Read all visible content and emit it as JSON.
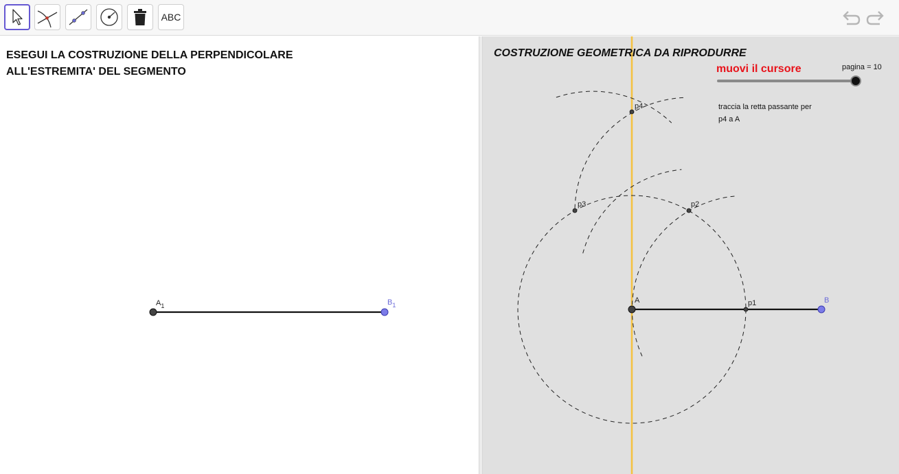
{
  "toolbar": {
    "tools": [
      {
        "name": "move",
        "icon": "cursor-arrow-icon",
        "active": true
      },
      {
        "name": "intersect",
        "icon": "intersect-icon"
      },
      {
        "name": "segment",
        "icon": "segment-icon"
      },
      {
        "name": "compass",
        "icon": "compass-icon"
      },
      {
        "name": "delete",
        "icon": "trash-icon"
      },
      {
        "name": "text",
        "label": "ABC"
      }
    ],
    "undo_icon": "undo-icon",
    "redo_icon": "redo-icon"
  },
  "left_panel": {
    "instruction_line1": "ESEGUI LA COSTRUZIONE DELLA PERPENDICOLARE",
    "instruction_line2": "ALL'ESTREMITA' DEL SEGMENTO",
    "point_a_label": "A",
    "point_a_sub": "1",
    "point_b_label": "B",
    "point_b_sub": "1"
  },
  "right_panel": {
    "title": "COSTRUZIONE GEOMETRICA DA RIPRODURRE",
    "slider": {
      "label": "muovi il cursore",
      "value_text": "pagina = 10",
      "value": 10,
      "min": 1,
      "max": 10
    },
    "step_text_line1": "traccia la retta passante per",
    "step_text_line2": "p4 a A",
    "labels": {
      "a": "A",
      "b": "B",
      "p1": "p1",
      "p2": "p2",
      "p3": "p3",
      "p4": "p4"
    }
  },
  "colors": {
    "accent": "#6557d2",
    "slider_label": "#e8131b",
    "perpendicular_line": "#f5c242",
    "free_point": "#7c7ce8",
    "fixed_point": "#444444",
    "graphics_bg": "#e0e0e0"
  }
}
